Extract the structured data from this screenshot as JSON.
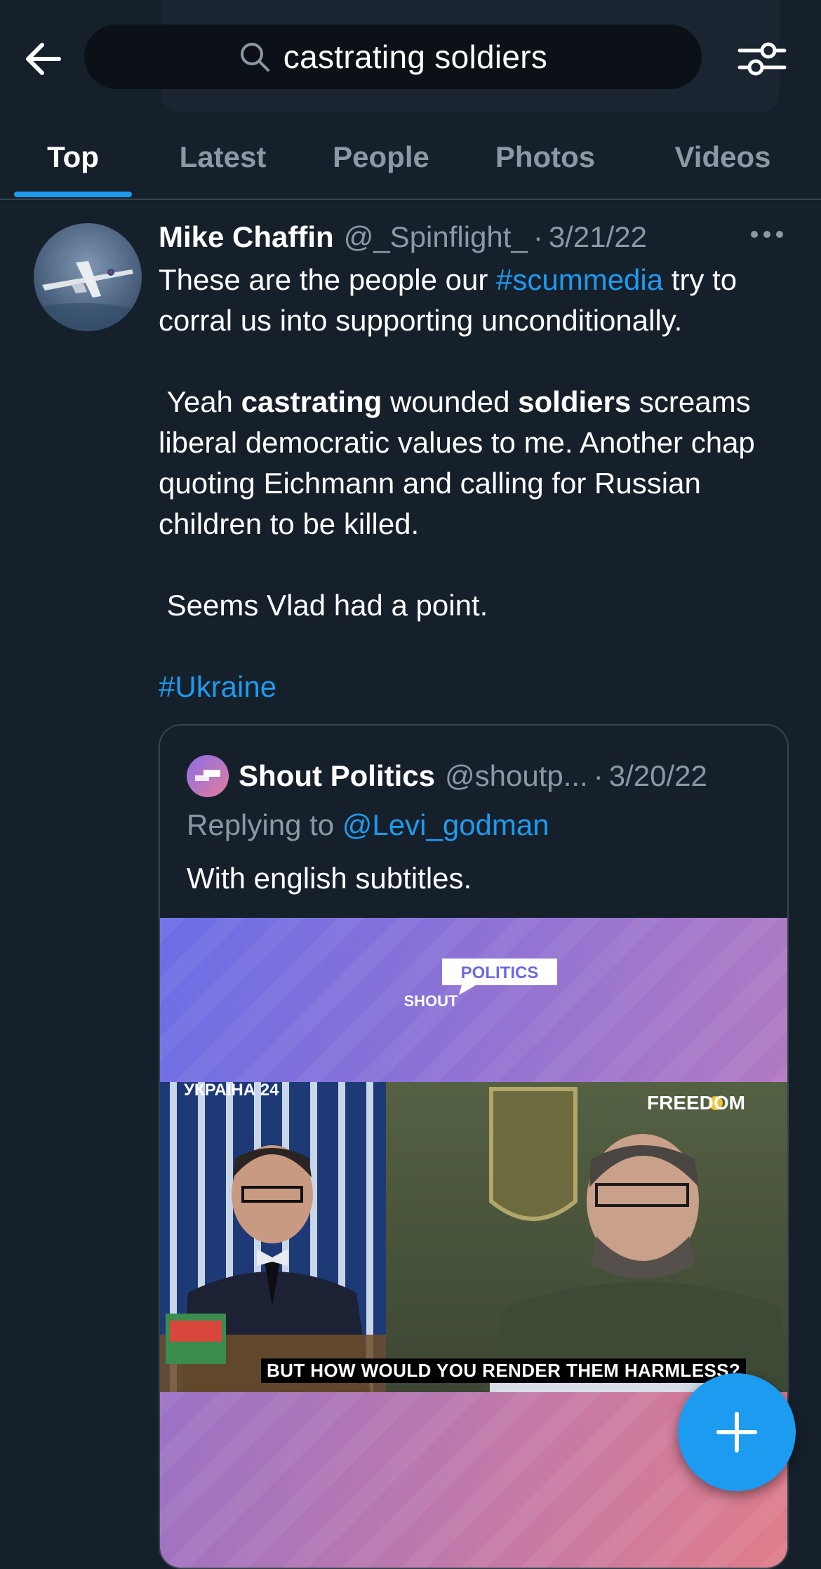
{
  "search": {
    "query": "castrating soldiers",
    "back_icon": "arrow-left-icon",
    "search_icon": "search-icon",
    "filter_icon": "filter-sliders-icon"
  },
  "tabs": [
    {
      "label": "Top",
      "active": true
    },
    {
      "label": "Latest",
      "active": false
    },
    {
      "label": "People",
      "active": false
    },
    {
      "label": "Photos",
      "active": false
    },
    {
      "label": "Videos",
      "active": false
    }
  ],
  "tweet": {
    "author_name": "Mike Chaffin",
    "handle": "@_Spinflight_",
    "separator": "·",
    "date": "3/21/22",
    "more_icon": "more-horizontal-icon",
    "text": {
      "p1_a": "These are the people our ",
      "p1_hashtag": "#scummedia",
      "p1_b": " try to corral us into supporting unconditionally.",
      "p2_a": " Yeah ",
      "p2_bold1": "castrating",
      "p2_b": " wounded ",
      "p2_bold2": "soldiers",
      "p2_c": " screams liberal democratic values to me. Another chap quoting Eichmann and calling for Russian children to be killed.",
      "p3": " Seems Vlad had a point.",
      "p4_hashtag": "#Ukraine"
    }
  },
  "quote": {
    "author_name": "Shout Politics",
    "handle": "@shoutp...",
    "separator": "·",
    "date": "3/20/22",
    "replying_prefix": "Replying to ",
    "replying_handle": "@Levi_godman",
    "text": "With english subtitles.",
    "media": {
      "logo_line1": "POLITICS",
      "logo_line2": "SHOUT",
      "channel_label": "УКРАЇНА 24",
      "freedom_label": "FREEDOM",
      "subtitle": "BUT HOW WOULD YOU RENDER THEM HARMLESS?"
    }
  },
  "fab": {
    "icon": "plus-icon",
    "label": "Compose"
  },
  "colors": {
    "background": "#16202b",
    "accent": "#1d9bf0",
    "secondary_text": "#8b98a5",
    "border": "#38444d"
  }
}
